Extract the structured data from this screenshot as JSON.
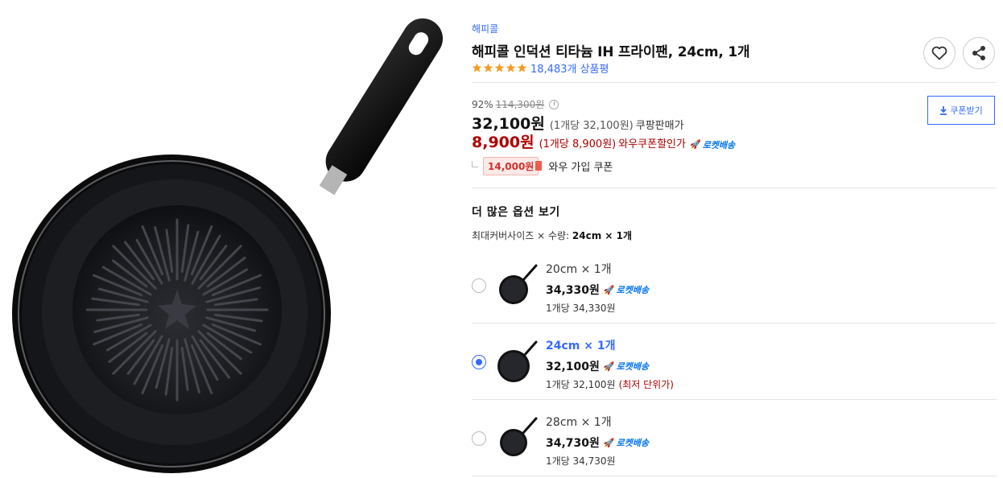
{
  "product": {
    "brand": "해피콜",
    "title": "해피콜 인덕션 티타늄 IH 프라이팬, 24cm, 1개",
    "rating_stars": 5,
    "review_count": "18,483개 상품평"
  },
  "actions": {
    "wishlist_icon": "heart-icon",
    "share_icon": "share-icon",
    "coupon_button": "쿠폰받기"
  },
  "pricing": {
    "discount_rate": "92%",
    "original_price": "114,300원",
    "sale_price": "32,100원",
    "sale_unit": "(1개당 32,100원)",
    "sale_label": "쿠팡판매가",
    "wow_price": "8,900원",
    "wow_unit": "(1개당 8,900원)",
    "wow_label": "와우쿠폰할인가",
    "rocket_label": "로켓배송",
    "coupon_amount": "14,000원",
    "coupon_desc": "와우 가입 쿠폰"
  },
  "options": {
    "heading": "더 많은 옵션 보기",
    "summary_prefix": "최대커버사이즈 × 수량:",
    "summary_value": "24cm × 1개",
    "items": [
      {
        "name": "20cm × 1개",
        "price": "34,330원",
        "delivery": "로켓배송",
        "unit_price": "1개당 34,330원",
        "note": "",
        "selected": false
      },
      {
        "name": "24cm × 1개",
        "price": "32,100원",
        "delivery": "로켓배송",
        "unit_price": "1개당 32,100원",
        "note": "(최저 단위가)",
        "selected": true
      },
      {
        "name": "28cm × 1개",
        "price": "34,730원",
        "delivery": "로켓배송",
        "unit_price": "1개당 34,730원",
        "note": "",
        "selected": false
      }
    ]
  },
  "colors": {
    "accent_blue": "#346aff",
    "wow_red": "#ae0000",
    "star_orange": "#f59b22"
  }
}
